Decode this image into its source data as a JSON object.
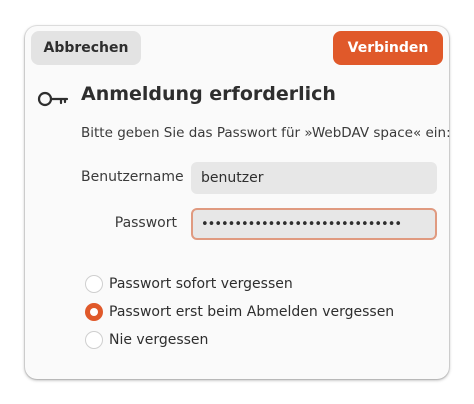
{
  "dialog": {
    "cancel_label": "Abbrechen",
    "connect_label": "Verbinden",
    "title": "Anmeldung erforderlich",
    "message": "Bitte geben Sie das Passwort für »WebDAV space« ein:",
    "icon": "key-icon"
  },
  "form": {
    "username_label": "Benutzername",
    "username_value": "benutzer",
    "password_label": "Passwort",
    "password_value": "••••••••••••••••••••••••••••••"
  },
  "remember": {
    "options": [
      {
        "label": "Passwort sofort vergessen",
        "checked": false
      },
      {
        "label": "Passwort erst beim Abmelden vergessen",
        "checked": true
      },
      {
        "label": "Nie vergessen",
        "checked": false
      }
    ]
  },
  "colors": {
    "accent": "#e0592a"
  }
}
